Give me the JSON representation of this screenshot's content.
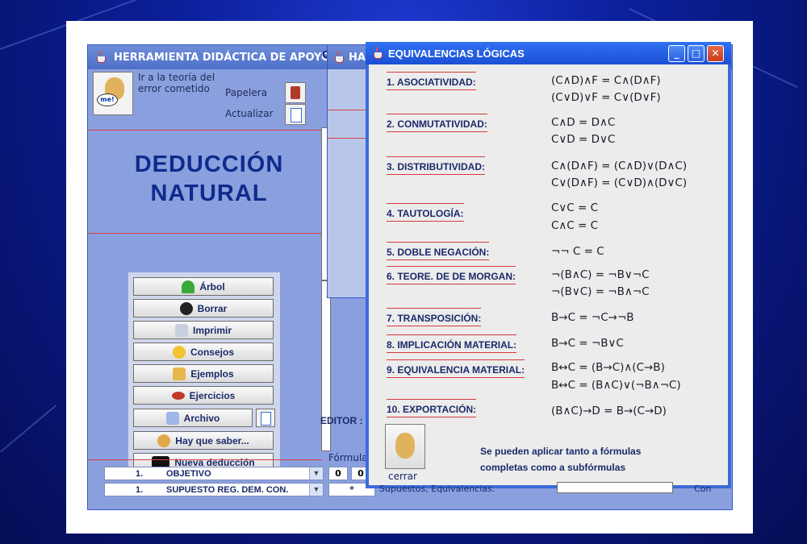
{
  "main_window": {
    "title": "HERRAMIENTA DIDÁCTICA DE APOYO PAR",
    "go_to_theory_line1": "Ir a la teoría del",
    "go_to_theory_line2": "error cometido",
    "mascot_bubble": "me!",
    "papelera_label": "Papelera",
    "actualizar_label": "Actualizar",
    "heading_line1": "DEDUCCIÓN",
    "heading_line2": "NATURAL",
    "menu": [
      {
        "label": "Árbol",
        "icon": "tree-icon"
      },
      {
        "label": "Borrar",
        "icon": "bomb-icon"
      },
      {
        "label": "Imprimir",
        "icon": "printer-icon"
      },
      {
        "label": "Consejos",
        "icon": "thinking-face-icon"
      },
      {
        "label": "Ejemplos",
        "icon": "folder-icon"
      },
      {
        "label": "Ejercicios",
        "icon": "bicycle-icon"
      },
      {
        "label": "Archivo",
        "icon": "file-icon"
      },
      {
        "label": "Hay que saber...",
        "icon": "face-icon"
      },
      {
        "label": "Nueva deducción",
        "icon": "swoosh-icon"
      }
    ],
    "objetivo_row": {
      "num": "1.",
      "label": "OBJETIVO"
    },
    "supuesto_row": {
      "num": "1.",
      "label": "SUPUESTO REG. DEM. CON."
    },
    "editor_label": "EDITOR :",
    "formula_label": "Fórmula",
    "col_marker": "O",
    "box_zero_1": "0",
    "box_zero_2": "0",
    "asterisks": "*",
    "bottom_truncated": "Supuestos, Equivalencias.",
    "bottom_right_truncated": "Con"
  },
  "second_window": {
    "title": "HA"
  },
  "dialog": {
    "title": "EQUIVALENCIAS LÓGICAS",
    "equivalences": [
      {
        "name": "1. ASOCIATIVIDAD:",
        "formulas": [
          "(C∧D)∧F  =  C∧(D∧F)",
          "(C∨D)∨F  =  C∨(D∨F)"
        ]
      },
      {
        "name": "2. CONMUTATIVIDAD:",
        "formulas": [
          "C∧D  =  D∧C",
          "C∨D  =  D∨C"
        ]
      },
      {
        "name": "3. DISTRIBUTIVIDAD:",
        "formulas": [
          "C∧(D∧F)  =  (C∧D)∨(D∧C)",
          "C∨(D∧F)  =  (C∨D)∧(D∨C)"
        ]
      },
      {
        "name": "4. TAUTOLOGÍA:",
        "formulas": [
          "C∨C  =  C",
          "C∧C  =  C"
        ]
      },
      {
        "name": "5. DOBLE NEGACIÓN:",
        "formulas": [
          "¬¬  C  =  C"
        ]
      },
      {
        "name": "6. TEORE. DE  DE MORGAN:",
        "formulas": [
          "¬(B∧C)  =  ¬B∨¬C",
          "¬(B∨C)  =  ¬B∧¬C"
        ]
      },
      {
        "name": "7. TRANSPOSICIÓN:",
        "formulas": [
          "B→C  =  ¬C→¬B"
        ]
      },
      {
        "name": "8. IMPLICACIÓN MATERIAL:",
        "formulas": [
          "B→C  =  ¬B∨C"
        ]
      },
      {
        "name": "9. EQUIVALENCIA MATERIAL:",
        "formulas": [
          "B↔C  =  (B→C)∧(C→B)",
          "B↔C  =  (B∧C)∨(¬B∧¬C)"
        ]
      },
      {
        "name": "10. EXPORTACIÓN:",
        "formulas": [
          "(B∧C)→D  =  B→(C→D)"
        ]
      }
    ],
    "note_line1": "Se pueden aplicar tanto a fórmulas",
    "note_line2": "completas como a subfórmulas",
    "close_label": "cerrar",
    "minimize": "_",
    "maximize": "□",
    "close_x": "✕"
  },
  "colors": {
    "accent_blue": "#0e2b8c",
    "divider_red": "#d94040",
    "title_bar": "#2f72f2"
  }
}
